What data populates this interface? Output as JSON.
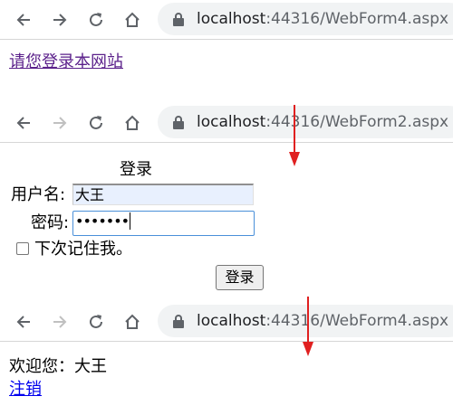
{
  "colors": {
    "arrow": "#e02020",
    "link_visited": "#5a1f8a",
    "link": "#0000ee",
    "omnibox_bg": "#f1f3f4",
    "input_focus": "#4a90d9",
    "autofill_bg": "#e8f0fe"
  },
  "screens": [
    {
      "url_host": "localhost",
      "url_path": ":44316/WebForm4.aspx",
      "forward_enabled": true,
      "login_link": "请您登录本网站"
    },
    {
      "url_host": "localhost",
      "url_path": ":44316/WebForm2.aspx",
      "forward_enabled": false,
      "login_form": {
        "title": "登录",
        "username_label": "用户名:",
        "username_value": "大王",
        "password_label": "密码:",
        "password_value": "•••••••",
        "remember_label": "下次记住我。",
        "submit_label": "登录"
      }
    },
    {
      "url_host": "localhost",
      "url_path": ":44316/WebForm4.aspx",
      "forward_enabled": false,
      "welcome_text": "欢迎您：大王",
      "logout_link": "注销"
    }
  ]
}
